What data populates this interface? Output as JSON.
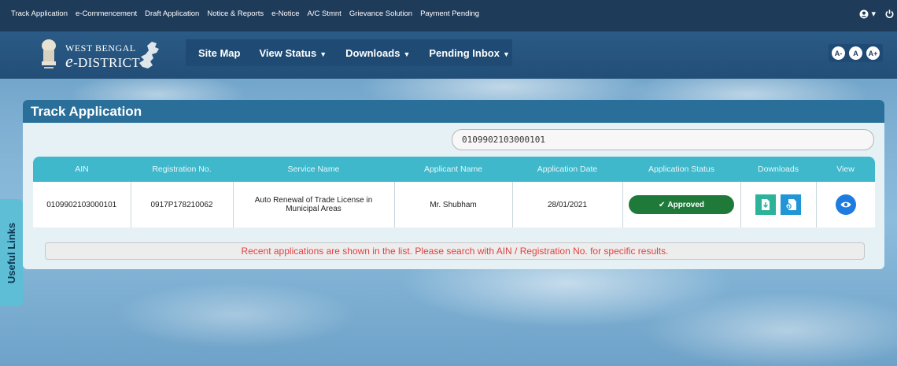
{
  "topbar": {
    "links": [
      "Track Application",
      "e-Commencement",
      "Draft Application",
      "Notice & Reports",
      "e-Notice",
      "A/C Stmnt",
      "Grievance Solution",
      "Payment Pending"
    ],
    "user_caret": "▾"
  },
  "brand": {
    "line1": "WEST BENGAL",
    "line2_prefix": "e",
    "line2_rest": "-DISTRICT"
  },
  "mainnav": {
    "items": [
      {
        "label": "Site Map",
        "dropdown": false
      },
      {
        "label": "View Status",
        "dropdown": true
      },
      {
        "label": "Downloads",
        "dropdown": true
      },
      {
        "label": "Pending Inbox",
        "dropdown": true
      }
    ]
  },
  "fontsize": {
    "decrease": "A-",
    "normal": "A",
    "increase": "A+"
  },
  "panel": {
    "title": "Track Application",
    "search_value": "0109902103000101"
  },
  "table": {
    "headers": [
      "AIN",
      "Registration No.",
      "Service Name",
      "Applicant Name",
      "Application Date",
      "Application Status",
      "Downloads",
      "View"
    ],
    "rows": [
      {
        "ain": "0109902103000101",
        "registration_no": "0917P178210062",
        "service_name": "Auto Renewal of Trade License in Municipal Areas",
        "applicant_name": "Mr. Shubham",
        "application_date": "28/01/2021",
        "status": "Approved"
      }
    ]
  },
  "notice": "Recent applications are shown in the list. Please search with AIN / Registration No. for specific results.",
  "useful_links": "Useful Links",
  "colors": {
    "topbar": "#1f3b5a",
    "header": "#2a5b86",
    "table_header": "#3fb8cb",
    "approved": "#1f7a3a",
    "notice_text": "#e04242"
  }
}
